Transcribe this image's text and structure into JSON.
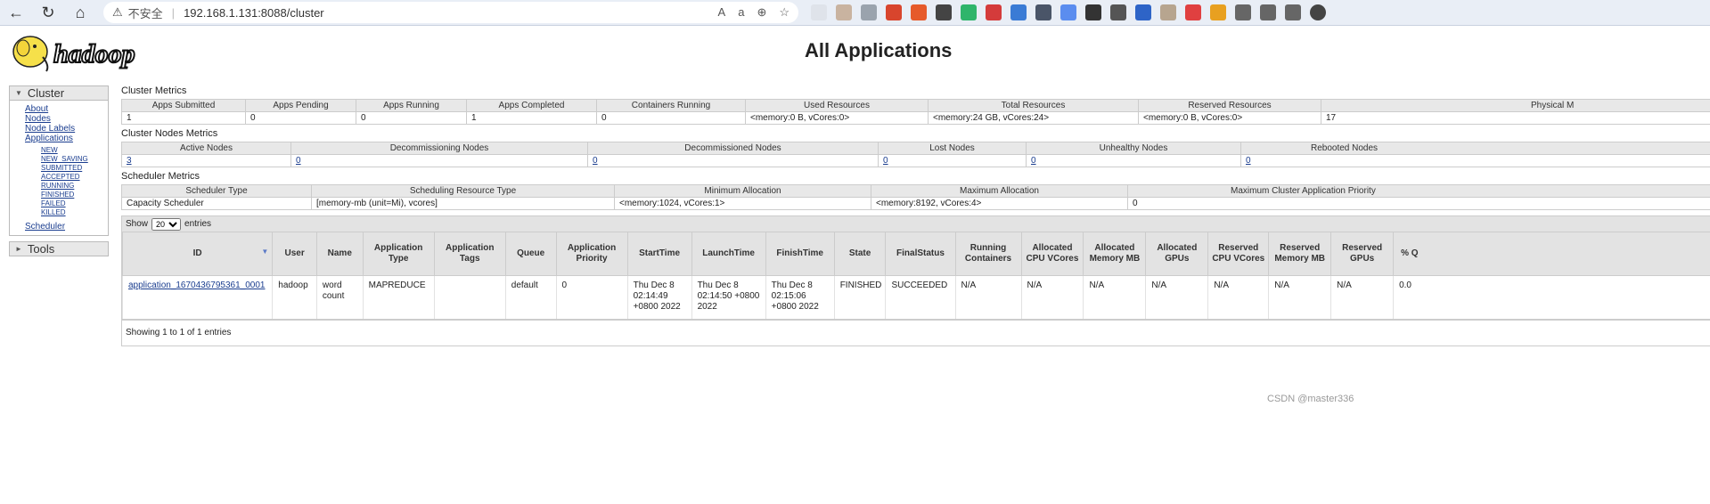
{
  "browser": {
    "insecure_label": "不安全",
    "url": "192.168.1.131:8088/cluster"
  },
  "header": {
    "logo_text": "hadoop",
    "title": "All Applications"
  },
  "nav": {
    "cluster_label": "Cluster",
    "links": [
      "About",
      "Nodes",
      "Node Labels",
      "Applications"
    ],
    "app_states": [
      "NEW",
      "NEW_SAVING",
      "SUBMITTED",
      "ACCEPTED",
      "RUNNING",
      "FINISHED",
      "FAILED",
      "KILLED"
    ],
    "scheduler_label": "Scheduler",
    "tools_label": "Tools"
  },
  "cluster_metrics": {
    "title": "Cluster Metrics",
    "headers": [
      "Apps Submitted",
      "Apps Pending",
      "Apps Running",
      "Apps Completed",
      "Containers Running",
      "Used Resources",
      "Total Resources",
      "Reserved Resources",
      "Physical M"
    ],
    "values": [
      "1",
      "0",
      "0",
      "1",
      "0",
      "<memory:0 B, vCores:0>",
      "<memory:24 GB, vCores:24>",
      "<memory:0 B, vCores:0>",
      "17"
    ]
  },
  "node_metrics": {
    "title": "Cluster Nodes Metrics",
    "headers": [
      "Active Nodes",
      "Decommissioning Nodes",
      "Decommissioned Nodes",
      "Lost Nodes",
      "Unhealthy Nodes",
      "Rebooted Nodes"
    ],
    "values": [
      "3",
      "0",
      "0",
      "0",
      "0",
      "0"
    ]
  },
  "scheduler_metrics": {
    "title": "Scheduler Metrics",
    "headers": [
      "Scheduler Type",
      "Scheduling Resource Type",
      "Minimum Allocation",
      "Maximum Allocation",
      "Maximum Cluster Application Priority"
    ],
    "values": [
      "Capacity Scheduler",
      "[memory-mb (unit=Mi), vcores]",
      "<memory:1024, vCores:1>",
      "<memory:8192, vCores:4>",
      "0"
    ]
  },
  "apps": {
    "show_label": "Show",
    "entries_label": "entries",
    "page_size": "20",
    "columns": [
      "ID",
      "User",
      "Name",
      "Application Type",
      "Application Tags",
      "Queue",
      "Application Priority",
      "StartTime",
      "LaunchTime",
      "FinishTime",
      "State",
      "FinalStatus",
      "Running Containers",
      "Allocated CPU VCores",
      "Allocated Memory MB",
      "Allocated GPUs",
      "Reserved CPU VCores",
      "Reserved Memory MB",
      "Reserved GPUs",
      "% Q"
    ],
    "rows": [
      {
        "id": "application_1670436795361_0001",
        "user": "hadoop",
        "name": "word count",
        "type": "MAPREDUCE",
        "tags": "",
        "queue": "default",
        "priority": "0",
        "start": "Thu Dec 8 02:14:49 +0800 2022",
        "launch": "Thu Dec 8 02:14:50 +0800 2022",
        "finish": "Thu Dec 8 02:15:06 +0800 2022",
        "state": "FINISHED",
        "final_status": "SUCCEEDED",
        "running_containers": "N/A",
        "alloc_cpu": "N/A",
        "alloc_mem": "N/A",
        "alloc_gpu": "N/A",
        "res_cpu": "N/A",
        "res_mem": "N/A",
        "res_gpu": "N/A",
        "pct": "0.0"
      }
    ],
    "footer": "Showing 1 to 1 of 1 entries"
  },
  "watermark": "CSDN @master336"
}
